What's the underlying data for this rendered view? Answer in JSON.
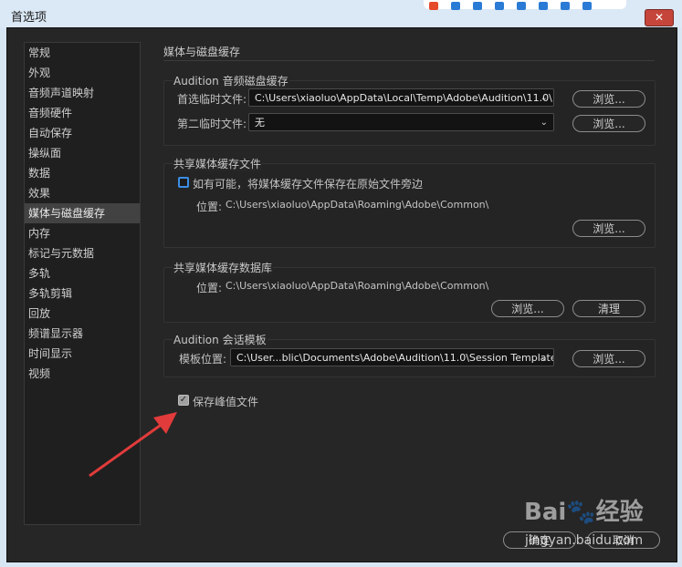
{
  "window": {
    "title": "首选项",
    "close_label": "✕"
  },
  "sidebar": {
    "items": [
      {
        "label": "常规"
      },
      {
        "label": "外观"
      },
      {
        "label": "音频声道映射"
      },
      {
        "label": "音频硬件"
      },
      {
        "label": "自动保存"
      },
      {
        "label": "操纵面"
      },
      {
        "label": "数据"
      },
      {
        "label": "效果"
      },
      {
        "label": "媒体与磁盘缓存",
        "selected": true
      },
      {
        "label": "内存"
      },
      {
        "label": "标记与元数据"
      },
      {
        "label": "多轨"
      },
      {
        "label": "多轨剪辑"
      },
      {
        "label": "回放"
      },
      {
        "label": "频谱显示器"
      },
      {
        "label": "时间显示"
      },
      {
        "label": "视频"
      }
    ]
  },
  "pane": {
    "title": "媒体与磁盘缓存",
    "disk_cache": {
      "title": "Audition 音频磁盘缓存",
      "primary_label": "首选临时文件:",
      "primary_value": "C:\\Users\\xiaoluo\\AppData\\Local\\Temp\\Adobe\\Audition\\11.0\\",
      "secondary_label": "第二临时文件:",
      "secondary_value": "无",
      "browse_label": "浏览..."
    },
    "shared_cache": {
      "title": "共享媒体缓存文件",
      "checkbox_label": "如有可能，将媒体缓存文件保存在原始文件旁边",
      "checkbox_checked": false,
      "location_label": "位置:",
      "location_value": "C:\\Users\\xiaoluo\\AppData\\Roaming\\Adobe\\Common\\",
      "browse_label": "浏览..."
    },
    "shared_db": {
      "title": "共享媒体缓存数据库",
      "location_label": "位置:",
      "location_value": "C:\\Users\\xiaoluo\\AppData\\Roaming\\Adobe\\Common\\",
      "browse_label": "浏览...",
      "clean_label": "清理"
    },
    "session_template": {
      "title": "Audition 会话模板",
      "label": "模板位置:",
      "value": "C:\\User...blic\\Documents\\Adobe\\Audition\\11.0\\Session Templates",
      "browse_label": "浏览..."
    },
    "save_peak": {
      "label": "保存峰值文件",
      "checked": true
    }
  },
  "footer": {
    "ok_label": "确定",
    "cancel_label": "取消"
  },
  "watermark": {
    "brand": "Bai🐾经验",
    "url": "jingyan.baidu.com"
  },
  "colors": {
    "accent": "#3a8ee6",
    "annotation_arrow": "#e23b3b"
  }
}
